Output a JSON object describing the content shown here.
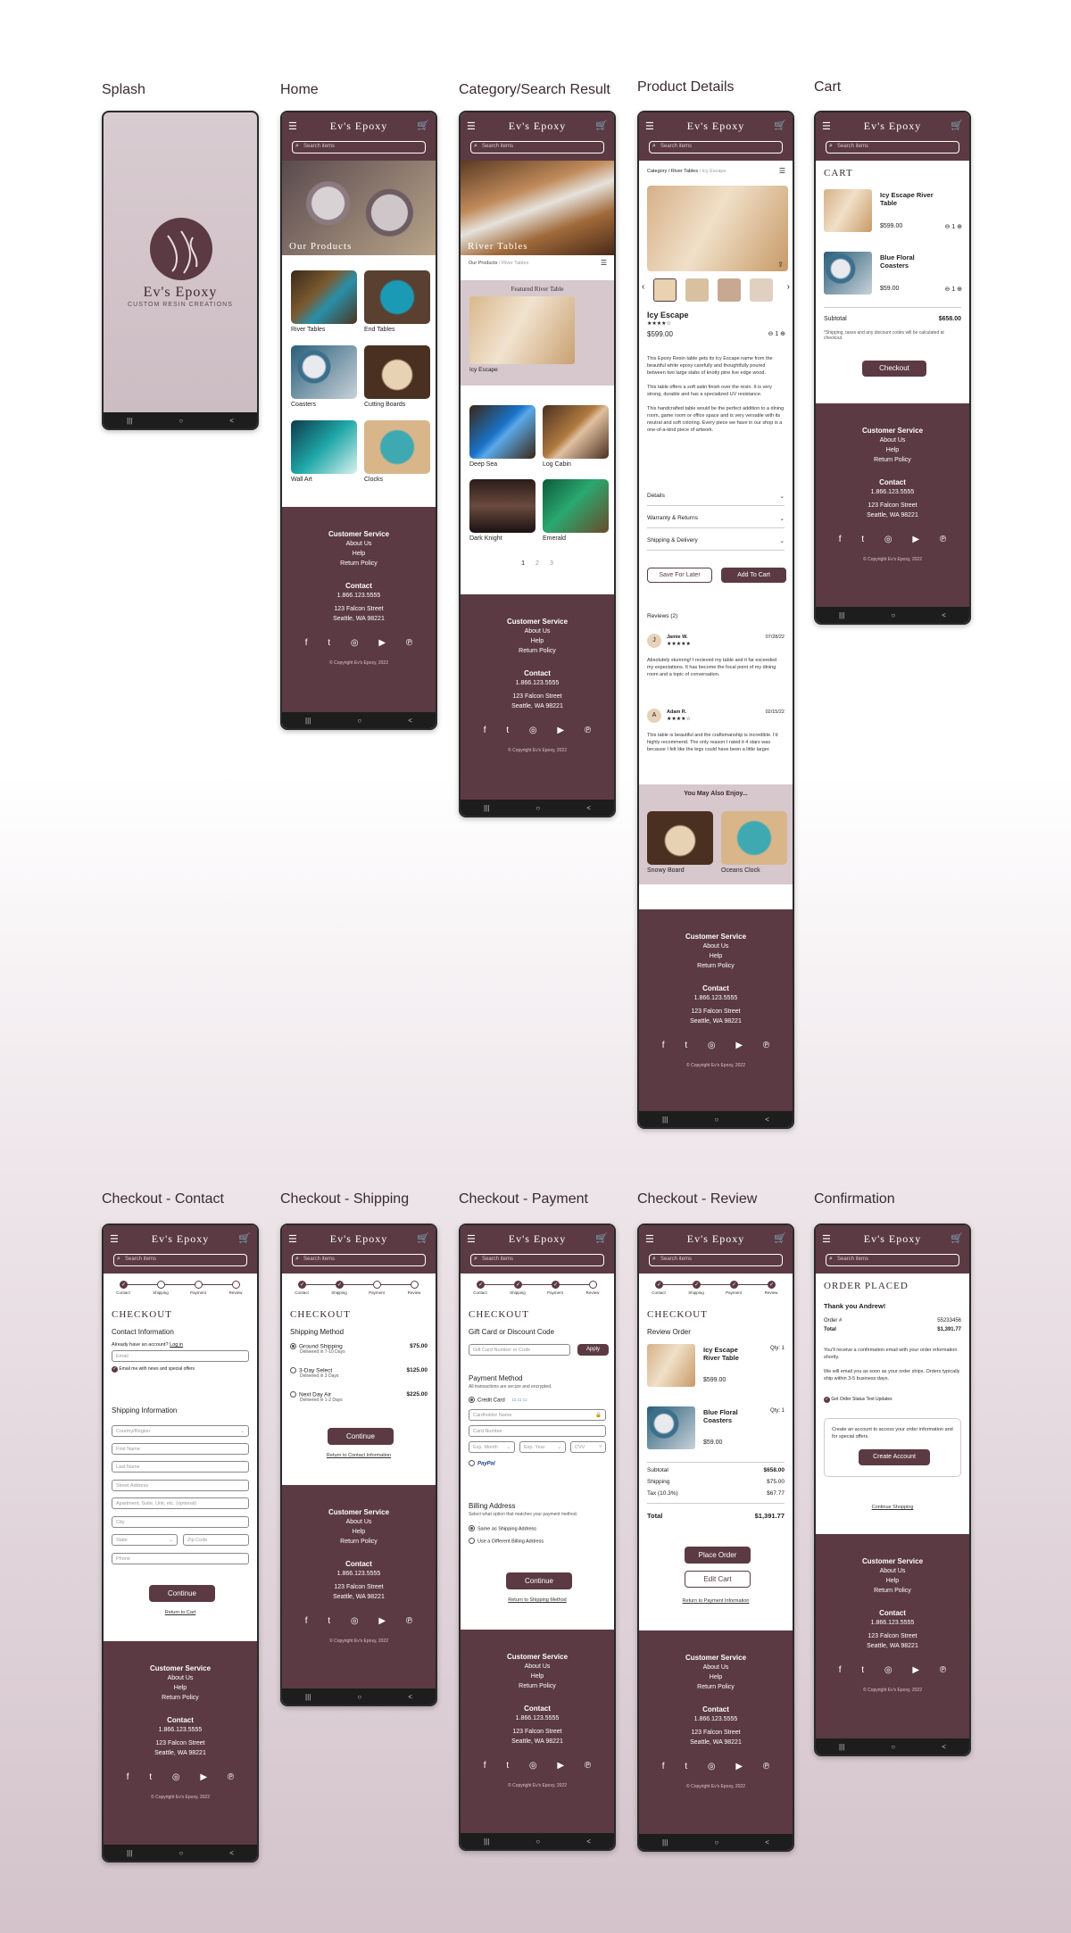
{
  "labels": {
    "splash": "Splash",
    "home": "Home",
    "category": "Category/Search Result",
    "product": "Product Details",
    "cart": "Cart",
    "co_contact": "Checkout - Contact",
    "co_shipping": "Checkout - Shipping",
    "co_payment": "Checkout - Payment",
    "co_review": "Checkout - Review",
    "confirm": "Confirmation"
  },
  "brand": "Ev's Epoxy",
  "splash": {
    "title": "Ev's Epoxy",
    "subtitle": "Custom Resin Creations"
  },
  "search_placeholder": "Search items",
  "footer": {
    "cs": "Customer Service",
    "about": "About Us",
    "help": "Help",
    "returns": "Return Policy",
    "contact": "Contact",
    "phone": "1.866.123.5555",
    "street": "123 Falcon Street",
    "city": "Seattle, WA 98221",
    "social": "f  t  ◎  ▶  ℗",
    "copyright": "© Copyright Ev's Epoxy, 2022"
  },
  "nav": {
    "recent": "|||",
    "home": "○",
    "back": "<"
  },
  "home": {
    "hero": "Our Products",
    "items": [
      "River Tables",
      "End Tables",
      "Coasters",
      "Cutting Boards",
      "Wall Art",
      "Clocks"
    ]
  },
  "category": {
    "hero": "River Tables",
    "crumb_a": "Our Products",
    "crumb_b": " / River Tables",
    "featured": "Featured River Table",
    "featured_name": "Icy Escape",
    "items": [
      "Deep Sea",
      "Log Cabin",
      "Dark Knight",
      "Emerald"
    ],
    "pages": [
      "1",
      "2",
      "3"
    ]
  },
  "product": {
    "crumb_a": "Category / River Tables",
    "crumb_b": " / Icy Escape",
    "name": "Icy Escape",
    "stars": "★★★★☆",
    "price": "$599.00",
    "qty": "1",
    "desc1": "This Epoxy Resin table gets its Icy Escape name from the beautiful white epoxy carefully and thoughtfully poured between two large slabs of knotty pine live edge wood.",
    "desc2": "This table offers a soft satin finish over the resin. It is very strong, durable and has a specialized UV resistance.",
    "desc3": "This handcrafted table would be the perfect addition to a dining room, game room or office space and is very versatile with its neutral and soft coloring. Every piece we have in our shop is a one-of-a-kind piece of artwork.",
    "acc": [
      "Details",
      "Warranty & Returns",
      "Shipping & Delivery"
    ],
    "save": "Save For Later",
    "add": "Add To Cart",
    "reviews": "Reviews (2)",
    "r1_name": "Jamie W.",
    "r1_date": "07/28/22",
    "r1_stars": "★★★★★",
    "r1_text": "Absolutely stunning! I recieved my table and it far exceeded my expectations. It has become the focal point of my dining room and a topic of conversation.",
    "r2_name": "Adam R.",
    "r2_date": "02/15/22",
    "r2_stars": "★★★★☆",
    "r2_text": "This table is beautiful and the craftsmanship is incredible. I'd highly recommend. The only reason I rated it 4 stars was because I felt like the legs could have been a little larger.",
    "also": "You May Also Enjoy...",
    "also_items": [
      "Snowy Board",
      "Oceans Clock"
    ]
  },
  "cart": {
    "title": "Cart",
    "i1_name": "Icy Escape River Table",
    "i1_price": "$599.00",
    "i2_name": "Blue Floral Coasters",
    "i2_price": "$59.00",
    "qty": "1",
    "subtotal_l": "Subtotal",
    "subtotal": "$658.00",
    "note": "*Shipping, taxes and any discount codes will be calculated at checkout.",
    "checkout": "Checkout"
  },
  "steps": [
    "Contact",
    "Shipping",
    "Payment",
    "Review"
  ],
  "checkout": {
    "title": "Checkout",
    "continue": "Continue"
  },
  "co_contact": {
    "ci": "Contact Information",
    "have": "Already have an account?",
    "login": "Log in",
    "email": "Email",
    "news": "Email me with news and special offers",
    "si": "Shipping Information",
    "country": "Country/Region",
    "first": "First Name",
    "last": "Last Name",
    "street": "Street Address",
    "apt": "Apartment, Suite, Unit, etc. (optional)",
    "city": "City",
    "state": "State",
    "zip": "Zip Code",
    "phone": "Phone",
    "back": "Return to Cart"
  },
  "co_shipping": {
    "method": "Shipping Method",
    "o1": "Ground Shipping",
    "o1d": "Delivered in 7-10 Days",
    "o1p": "$75.00",
    "o2": "3-Day Select",
    "o2d": "Delivered in 3 Days",
    "o2p": "$125.00",
    "o3": "Next Day Air",
    "o3d": "Delivered in 1-2 Days",
    "o3p": "$225.00",
    "back": "Return to Contact Information"
  },
  "co_payment": {
    "gift": "Gift Card or Discount Code",
    "gift_ph": "Gift Card Number or Code",
    "apply": "Apply",
    "pm": "Payment Method",
    "pm_note": "All transactions are secure and encrypted.",
    "cc": "Credit Card",
    "holder": "Cardholder Name",
    "number": "Card Number",
    "month": "Exp. Month",
    "year": "Exp. Year",
    "cvv": "CVV",
    "paypal": "PayPal",
    "billing": "Billing Address",
    "billing_note": "Select what option that matches your payment method.",
    "same": "Same as Shipping Address",
    "diff": "Use a Different Billing Address",
    "back": "Return to Shipping Method"
  },
  "co_review": {
    "ro": "Review Order",
    "i1_name": "Icy Escape River Table",
    "i1_price": "$599.00",
    "i2_name": "Blue Floral Coasters",
    "i2_price": "$59.00",
    "qty": "Qty: 1",
    "subtotal_l": "Subtotal",
    "subtotal": "$658.00",
    "ship_l": "Shipping",
    "ship": "$75.00",
    "tax_l": "Tax (10.3%)",
    "tax": "$67.77",
    "total_l": "Total",
    "total": "$1,391.77",
    "place": "Place Order",
    "edit": "Edit Cart",
    "back": "Return to Payment Information"
  },
  "confirm": {
    "title": "Order Placed",
    "thanks": "Thank you Andrew!",
    "order_l": "Order #",
    "order": "55233456",
    "total_l": "Total",
    "total": "$1,391.77",
    "p1": "You'll receive a confirmation email with your order information shortly.",
    "p2": "We will email you as soon as your order ships. Orders typically ship within 3-5 business days.",
    "text": "Get Order Status Text Updates",
    "acct": "Create an account to access your order information and for special offers.",
    "create": "Create Account",
    "cont": "Continue Shopping"
  }
}
